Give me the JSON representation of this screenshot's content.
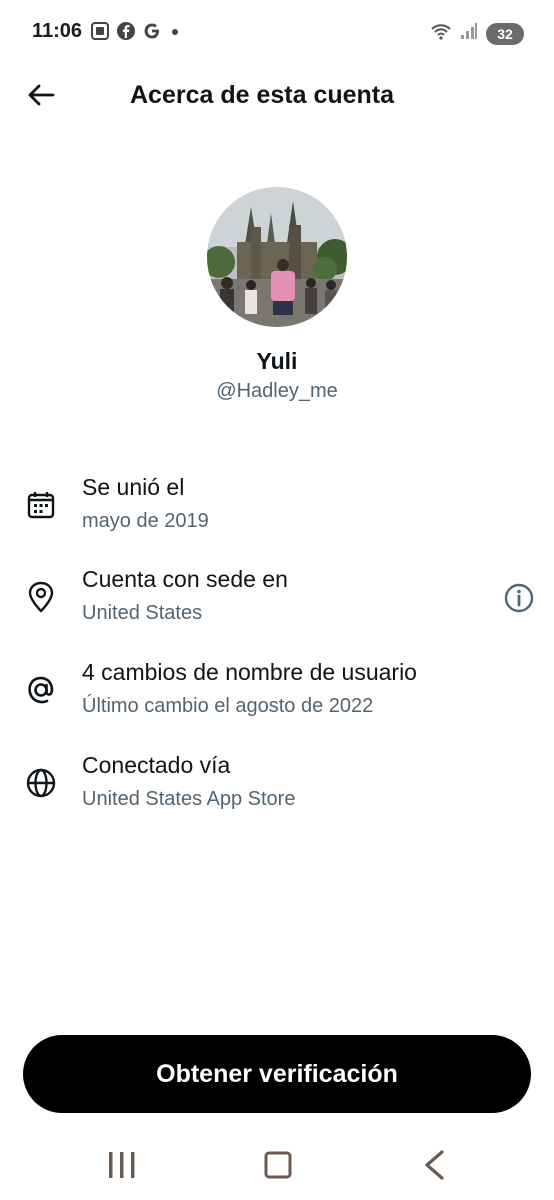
{
  "status_bar": {
    "time": "11:06",
    "battery": "32",
    "left_icons": [
      "screenshot-icon",
      "facebook-icon",
      "google-icon",
      "dot-icon"
    ],
    "right_icons": [
      "wifi-icon",
      "signal-icon",
      "battery-icon"
    ]
  },
  "header": {
    "title": "Acerca de esta cuenta",
    "back_icon": "arrow-left-icon"
  },
  "profile": {
    "display_name": "Yuli",
    "username": "@Hadley_me"
  },
  "info": [
    {
      "icon": "calendar-icon",
      "title": "Se unió el",
      "subtitle": "mayo de 2019"
    },
    {
      "icon": "location-pin-icon",
      "title": "Cuenta con sede en",
      "subtitle": "United States",
      "extra_icon": "info-icon"
    },
    {
      "icon": "at-sign-icon",
      "title": "4 cambios de nombre de usuario",
      "subtitle": "Último cambio el agosto de 2022"
    },
    {
      "icon": "globe-icon",
      "title": "Conectado vía",
      "subtitle": "United States App Store"
    }
  ],
  "verify_button": {
    "label": "Obtener verificación"
  },
  "nav_bar": {
    "buttons": [
      "recent-apps-icon",
      "home-icon",
      "back-icon"
    ]
  },
  "colors": {
    "text_primary": "#0f1419",
    "text_secondary": "#536471",
    "button_bg": "#000000",
    "button_text": "#ffffff",
    "nav_icon": "#6b5a4f"
  }
}
